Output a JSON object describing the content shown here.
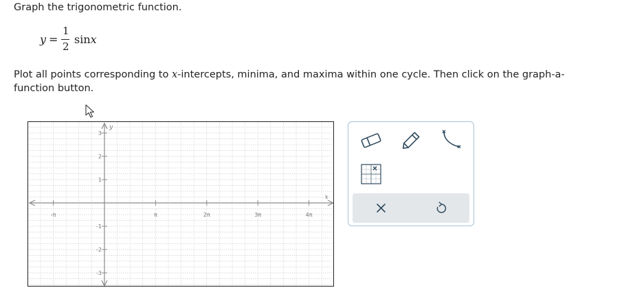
{
  "prompt": "Graph the trigonometric function.",
  "equation": {
    "lhs": "y",
    "equals": "=",
    "numerator": "1",
    "denominator": "2",
    "func": "sin",
    "var": "x"
  },
  "instructions": {
    "part1": "Plot all points corresponding to ",
    "var": "x",
    "part2": "-intercepts, minima, and maxima within one cycle. Then click on the graph-a-function button."
  },
  "graph": {
    "x_axis_label": "x",
    "y_axis_label": "y",
    "x_ticks": [
      "-π",
      "π",
      "2π",
      "3π",
      "4π"
    ],
    "y_ticks": [
      "3",
      "2",
      "1",
      "-1",
      "-2",
      "-3"
    ],
    "axis_color": "#8a8a8a",
    "grid_color": "#d0d0d0"
  },
  "toolbox": {
    "tools": [
      {
        "name": "eraser",
        "icon": "eraser-icon"
      },
      {
        "name": "pencil",
        "icon": "pencil-icon"
      },
      {
        "name": "graph-a-function",
        "icon": "curve-icon"
      },
      {
        "name": "point-grid",
        "icon": "grid-point-icon"
      }
    ],
    "actions": [
      {
        "name": "clear",
        "icon": "close-icon",
        "glyph": "✕"
      },
      {
        "name": "undo",
        "icon": "undo-icon",
        "glyph": "↺"
      }
    ],
    "border_color": "#a9c2d6",
    "action_bar_color": "#e3e7ea",
    "icon_color": "#2e4a5e"
  }
}
